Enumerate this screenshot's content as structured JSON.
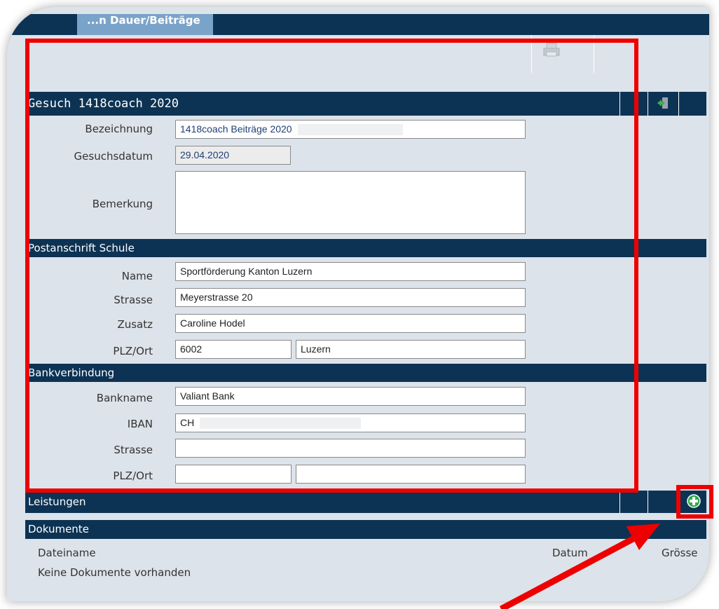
{
  "colors": {
    "header_bg": "#0d3354",
    "tab_bg": "#7aa3c9",
    "panel_bg": "#dde3ea",
    "highlight_red": "#ee0000",
    "icon_green": "#2ea84a"
  },
  "toolbar": {
    "tab_label": "...n Dauer/Beiträge",
    "print_icon": "printer-icon"
  },
  "gesuch": {
    "header": "Gesuch 1418coach 2020",
    "exit_icon": "exit-door-icon",
    "fields": {
      "bezeichnung": {
        "label": "Bezeichnung",
        "value": "1418coach Beiträge 2020"
      },
      "gesuchsdatum": {
        "label": "Gesuchsdatum",
        "value": "29.04.2020"
      },
      "bemerkung": {
        "label": "Bemerkung",
        "value": ""
      }
    }
  },
  "postanschrift": {
    "header": "Postanschrift Schule",
    "name": {
      "label": "Name",
      "value": "Sportförderung Kanton Luzern"
    },
    "strasse": {
      "label": "Strasse",
      "value": "Meyerstrasse 20"
    },
    "zusatz": {
      "label": "Zusatz",
      "value": "Caroline Hodel"
    },
    "plzort": {
      "label": "PLZ/Ort",
      "plz": "6002",
      "ort": "Luzern"
    }
  },
  "bank": {
    "header": "Bankverbindung",
    "bankname": {
      "label": "Bankname",
      "value": "Valiant Bank"
    },
    "iban": {
      "label": "IBAN",
      "value": "CH"
    },
    "strasse": {
      "label": "Strasse",
      "value": ""
    },
    "plzort": {
      "label": "PLZ/Ort",
      "plz": "",
      "ort": ""
    }
  },
  "leistungen": {
    "header": "Leistungen",
    "add_icon": "plus-circle-icon"
  },
  "dokumente": {
    "header": "Dokumente",
    "columns": [
      "Dateiname",
      "Datum",
      "Grösse"
    ],
    "empty_text": "Keine Dokumente vorhanden"
  }
}
